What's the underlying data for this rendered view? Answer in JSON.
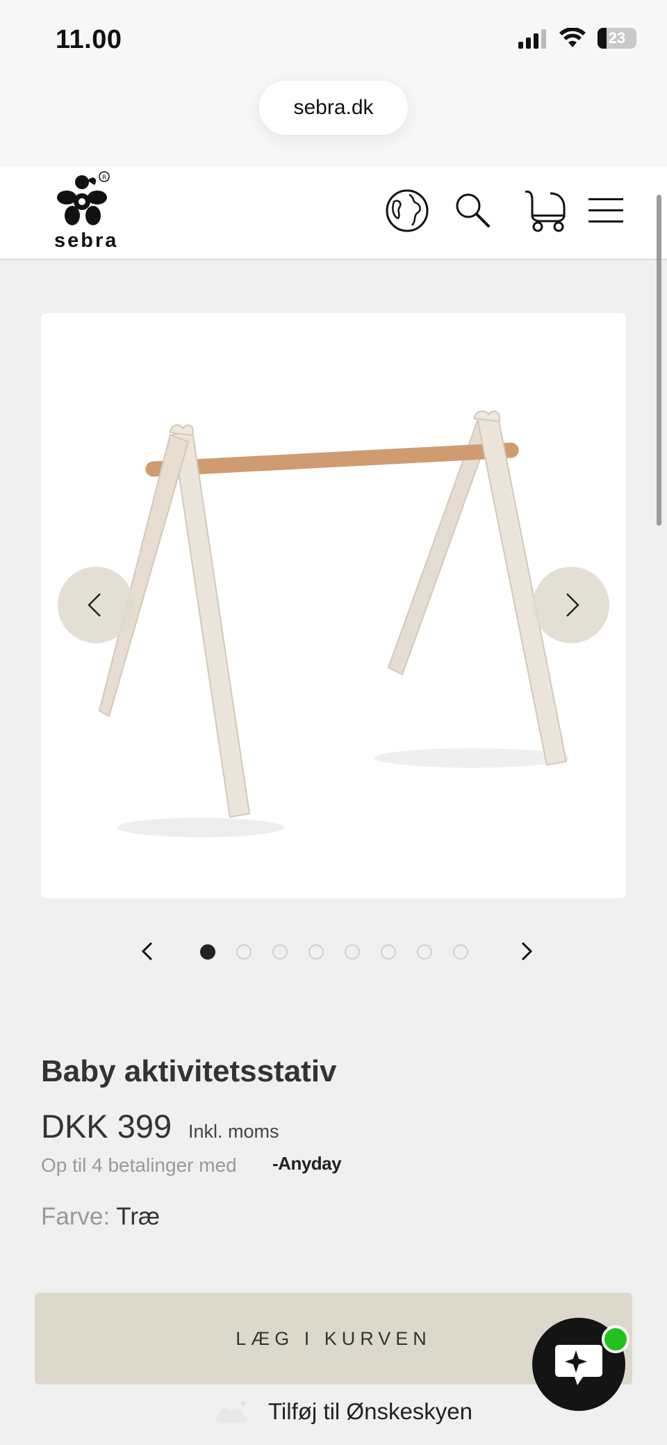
{
  "status_bar": {
    "time": "11.00",
    "battery": "23"
  },
  "browser": {
    "url": "sebra.dk"
  },
  "header": {
    "logo_text": "sebra",
    "icons": [
      "globe-icon",
      "search-icon",
      "pram-cart-icon",
      "menu-icon"
    ]
  },
  "gallery": {
    "total_images": 8,
    "active_index": 0
  },
  "product": {
    "title": "Baby aktivitetsstativ",
    "price": "DKK 399",
    "vat_note": "Inkl. moms",
    "installments": "Op til 4 betalinger med",
    "installments_provider": "Anyday",
    "color_label": "Farve:",
    "color_value": "Træ"
  },
  "actions": {
    "add_to_cart": "LÆG I KURVEN",
    "wishlist": "Tilføj til Ønskeskyen"
  },
  "colors": {
    "accent_button": "#ddd8cc",
    "chat_online": "#21c21f"
  }
}
